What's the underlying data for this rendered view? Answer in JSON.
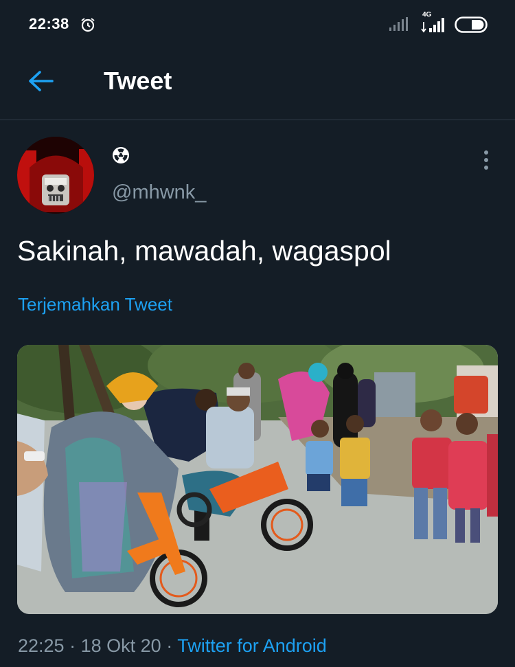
{
  "status_bar": {
    "time": "22:38",
    "network_label": "4G",
    "icons": [
      "alarm-icon",
      "signal-icon",
      "signal-4g-icon",
      "battery-icon"
    ]
  },
  "header": {
    "title": "Tweet",
    "back_icon": "back-arrow-icon"
  },
  "tweet": {
    "display_name_icon": "radioactive-icon",
    "handle": "@mhwnk_",
    "text": "Sakinah, mawadah, wagaspol",
    "translate_label": "Terjemahkan Tweet",
    "time": "22:25",
    "separator": "·",
    "date": "18 Okt 20",
    "client": "Twitter for Android"
  },
  "colors": {
    "background": "#141d26",
    "accent": "#1da1f2",
    "secondary_text": "#8899a6"
  }
}
